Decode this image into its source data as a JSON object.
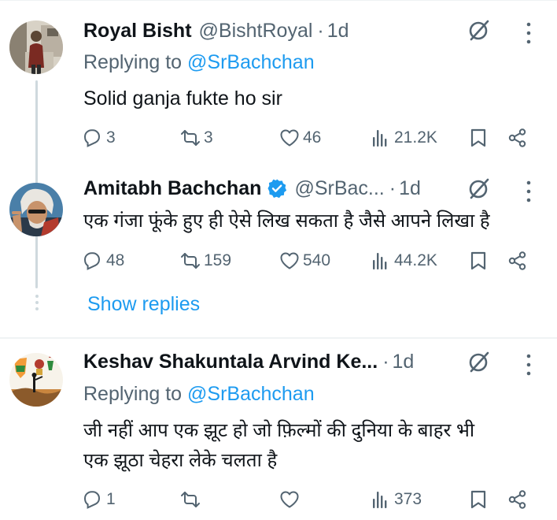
{
  "tweets": [
    {
      "name": "Royal Bisht",
      "handle": "@BishtRoyal",
      "separator": "·",
      "time": "1d",
      "replying_prefix": "Replying to ",
      "replying_to": "@SrBachchan",
      "text": "Solid ganja fukte ho sir",
      "replies": "3",
      "reposts": "3",
      "likes": "46",
      "views": "21.2K"
    },
    {
      "name": "Amitabh Bachchan",
      "handle": "@SrBac...",
      "separator": "·",
      "time": "1d",
      "verified": true,
      "text": "एक गंजा फूंके हुए ही ऐसे लिख सकता है जैसे आपने लिखा है",
      "replies": "48",
      "reposts": "159",
      "likes": "540",
      "views": "44.2K"
    },
    {
      "name": "Keshav Shakuntala Arvind Ke...",
      "separator": "·",
      "time": "1d",
      "replying_prefix": "Replying to ",
      "replying_to": "@SrBachchan",
      "text_line1": "जी नहीं आप एक झूट हो जो फ़िल्मों की दुनिया के बाहर भी",
      "text_line2": "एक झूठा चेहरा लेके चलता है",
      "replies": "1",
      "reposts": "",
      "likes": "",
      "views": "373"
    }
  ],
  "show_replies": "Show replies",
  "icons": [
    "grok-icon",
    "more-icon",
    "reply-icon",
    "repost-icon",
    "like-icon",
    "views-icon",
    "bookmark-icon",
    "share-icon",
    "verified-badge-icon"
  ],
  "colors": {
    "text": "#0f1419",
    "secondary": "#536471",
    "accent": "#1d9bf0",
    "divider": "#eff3f4",
    "thread_line": "#cfd9de"
  }
}
